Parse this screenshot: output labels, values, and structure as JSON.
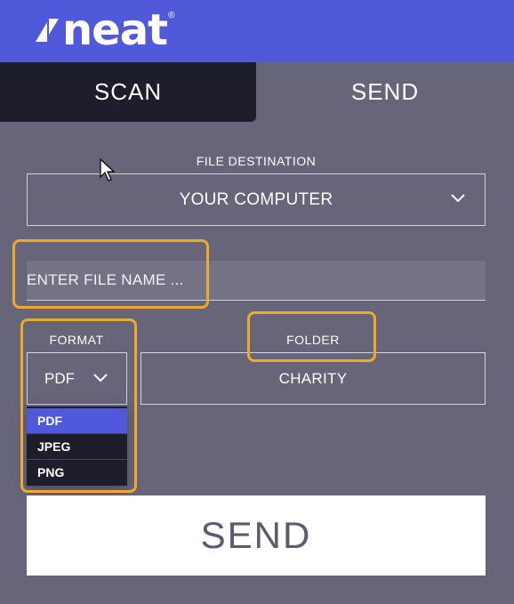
{
  "header": {
    "logo_text": "neat",
    "logo_mark": "®",
    "brand_color": "#5059d9"
  },
  "tabs": [
    {
      "label": "SCAN",
      "active": false
    },
    {
      "label": "SEND",
      "active": true
    }
  ],
  "destination": {
    "label": "FILE DESTINATION",
    "value": "YOUR COMPUTER",
    "icon": "chevron-down-icon"
  },
  "filename": {
    "placeholder": "ENTER FILE NAME ...",
    "value": ""
  },
  "format": {
    "label": "FORMAT",
    "value": "PDF",
    "icon": "chevron-down-icon",
    "options": [
      "PDF",
      "JPEG",
      "PNG"
    ],
    "selected_option": "PDF"
  },
  "folder": {
    "label": "FOLDER",
    "value": "CHARITY"
  },
  "send_button": {
    "label": "SEND"
  },
  "colors": {
    "highlight": "#efa92c",
    "panel": "#676579",
    "dark": "#1e1d2c"
  }
}
